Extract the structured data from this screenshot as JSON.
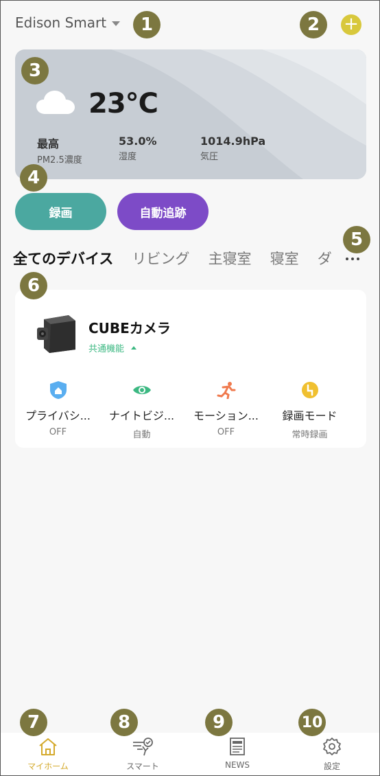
{
  "header": {
    "home_name": "Edison Smart",
    "add_icon": "plus-circle-icon",
    "accent": "#d8c83c"
  },
  "badges": [
    "1",
    "2",
    "3",
    "4",
    "5",
    "6",
    "7",
    "8",
    "9",
    "10"
  ],
  "weather": {
    "condition_icon": "cloud-icon",
    "temperature": "23°C",
    "stats": [
      {
        "value": "最高",
        "label": "PM2.5濃度"
      },
      {
        "value": "53.0%",
        "label": "湿度"
      },
      {
        "value": "1014.9hPa",
        "label": "気圧"
      }
    ]
  },
  "actions": {
    "record": "録画",
    "auto_track": "自動追跡"
  },
  "tabs": [
    "全てのデバイス",
    "リビング",
    "主寝室",
    "寝室",
    "ダ"
  ],
  "device": {
    "name": "CUBEカメラ",
    "function_toggle": "共通機能",
    "features": [
      {
        "name": "プライバシ...",
        "status": "OFF",
        "icon": "shield-home-icon",
        "color": "#5aaef0"
      },
      {
        "name": "ナイトビジ...",
        "status": "自動",
        "icon": "eye-icon",
        "color": "#3cb882"
      },
      {
        "name": "モーション...",
        "status": "OFF",
        "icon": "running-person-icon",
        "color": "#f07a4e"
      },
      {
        "name": "録画モード",
        "status": "常時録画",
        "icon": "record-mode-icon",
        "color": "#f0c030"
      }
    ]
  },
  "bottom_nav": [
    {
      "label": "マイホーム",
      "icon": "home-icon"
    },
    {
      "label": "スマート",
      "icon": "smart-scene-icon"
    },
    {
      "label": "NEWS",
      "icon": "newspaper-icon"
    },
    {
      "label": "設定",
      "icon": "gear-icon"
    }
  ]
}
